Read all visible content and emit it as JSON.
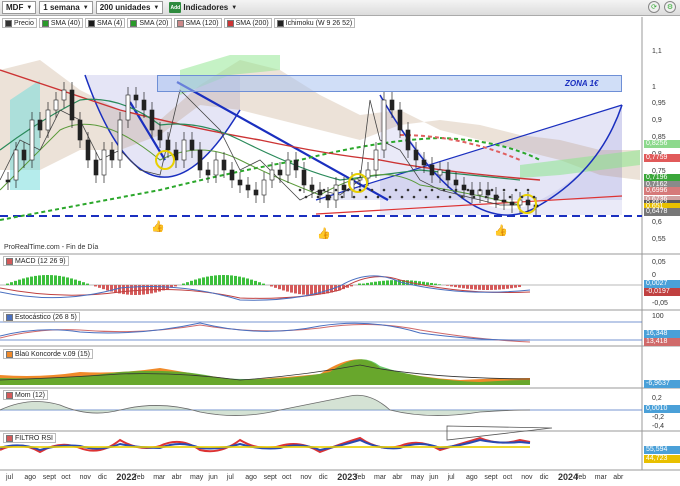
{
  "toolbar": {
    "symbol": "MDF",
    "period": "1 semana",
    "units": "200 unidades",
    "indicators": "Indicadores",
    "indicators_badge": "Add"
  },
  "legend": [
    "Precio",
    "SMA (40)",
    "SMA (4)",
    "SMA (20)",
    "SMA (120)",
    "SMA (200)",
    "Ichimoku (W 9 26 52)"
  ],
  "legend_colors": [
    "#333333",
    "#2a9a2a",
    "#1a1a1a",
    "#2a9a2a",
    "#cc8888",
    "#cc3333",
    "#222222"
  ],
  "zone_label": "ZONA 1€",
  "source": "ProRealTime.com - Fin de Día",
  "price_axis": [
    "1,1",
    "1",
    "0,95",
    "0,9",
    "0,85",
    "0,8",
    "0,75",
    "0,7",
    "0,65",
    "0,6",
    "0,55"
  ],
  "price_tags": [
    {
      "v": "0,8256",
      "c": "#8cd98c"
    },
    {
      "v": "0,7759",
      "c": "#e15a5a"
    },
    {
      "v": "0,7196",
      "c": "#3aa63a"
    },
    {
      "v": "0,7162",
      "c": "#8a8a8a"
    },
    {
      "v": "0,6996",
      "c": "#d67a7a"
    },
    {
      "v": "0,6736",
      "c": "#d0a0a0"
    },
    {
      "v": "0,6562",
      "c": "#5a5a5a"
    },
    {
      "v": "0,651",
      "c": "#e8c000"
    },
    {
      "v": "0,6478",
      "c": "#777777"
    }
  ],
  "macd": {
    "label": "MACD (12 26 9)",
    "axis": [
      "0,05",
      "0",
      "-0,05"
    ],
    "tags": [
      {
        "v": "0,0027",
        "c": "#4aa0d8"
      },
      {
        "v": "-0,0197",
        "c": "#c04040"
      }
    ]
  },
  "stoch": {
    "label": "Estocástico (26 8 5)",
    "axis": [
      "100",
      "0"
    ],
    "tags": [
      {
        "v": "16,348",
        "c": "#4aa0d8"
      },
      {
        "v": "13,418",
        "c": "#d06a6a"
      }
    ]
  },
  "blau": {
    "label": "Blaü Koncorde v.09 (15)",
    "tags": [
      {
        "v": "-6,9637",
        "c": "#4aa0d8"
      }
    ]
  },
  "mom": {
    "label": "Mom (12)",
    "axis": [
      "0,2",
      "0,010",
      "-0,2",
      "-0,4"
    ],
    "tags": [
      {
        "v": "0,0010",
        "c": "#4aa0d8"
      }
    ]
  },
  "rsi": {
    "label": "FILTRO RSI",
    "tags": [
      {
        "v": "55,594",
        "c": "#4aa0d8"
      },
      {
        "v": "44,723",
        "c": "#e8c000"
      }
    ]
  },
  "x_axis": [
    {
      "t": "jul",
      "b": false
    },
    {
      "t": "ago",
      "b": false
    },
    {
      "t": "sept",
      "b": false
    },
    {
      "t": "oct",
      "b": false
    },
    {
      "t": "nov",
      "b": false
    },
    {
      "t": "dic",
      "b": false
    },
    {
      "t": "2022",
      "b": true
    },
    {
      "t": "feb",
      "b": false
    },
    {
      "t": "mar",
      "b": false
    },
    {
      "t": "abr",
      "b": false
    },
    {
      "t": "may",
      "b": false
    },
    {
      "t": "jun",
      "b": false
    },
    {
      "t": "jul",
      "b": false
    },
    {
      "t": "ago",
      "b": false
    },
    {
      "t": "sept",
      "b": false
    },
    {
      "t": "oct",
      "b": false
    },
    {
      "t": "nov",
      "b": false
    },
    {
      "t": "dic",
      "b": false
    },
    {
      "t": "2023",
      "b": true
    },
    {
      "t": "feb",
      "b": false
    },
    {
      "t": "mar",
      "b": false
    },
    {
      "t": "abr",
      "b": false
    },
    {
      "t": "may",
      "b": false
    },
    {
      "t": "jun",
      "b": false
    },
    {
      "t": "jul",
      "b": false
    },
    {
      "t": "ago",
      "b": false
    },
    {
      "t": "sept",
      "b": false
    },
    {
      "t": "oct",
      "b": false
    },
    {
      "t": "nov",
      "b": false
    },
    {
      "t": "dic",
      "b": false
    },
    {
      "t": "2024",
      "b": true
    },
    {
      "t": "feb",
      "b": false
    },
    {
      "t": "mar",
      "b": false
    },
    {
      "t": "abr",
      "b": false
    }
  ]
}
